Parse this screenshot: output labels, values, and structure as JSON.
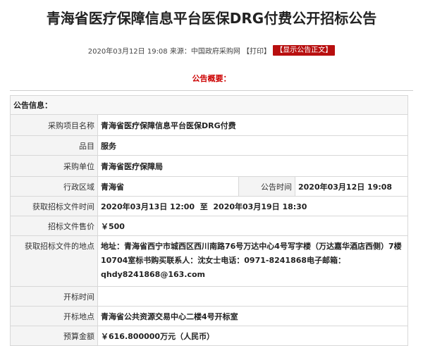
{
  "title": "青海省医疗保障信息平台医保DRG付费公开招标公告",
  "meta": {
    "datetime": "2020年03月12日 19:08",
    "source": "来源：中国政府采购网",
    "print": "【打印】",
    "show_body": "【显示公告正文】"
  },
  "overview_label": "公告概要：",
  "table": {
    "section_header": "公告信息：",
    "project_name_label": "采购项目名称",
    "project_name": "青海省医疗保障信息平台医保DRG付费",
    "category_label": "品目",
    "category": "服务",
    "purchaser_label": "采购单位",
    "purchaser": "青海省医疗保障局",
    "region_label": "行政区域",
    "region": "青海省",
    "announce_time_label": "公告时间",
    "announce_time": "2020年03月12日 19:08",
    "doc_time_label": "获取招标文件时间",
    "doc_time": "2020年03月13日 12:00  至  2020年03月19日 18:30",
    "doc_price_label": "招标文件售价",
    "doc_price": "￥500",
    "doc_place_label": "获取招标文件的地点",
    "doc_place": "地址：青海省西宁市城西区西川南路76号万达中心4号写字楼（万达嘉华酒店西侧）7楼10704室标书购买联系人：沈女士电话：0971-8241868电子邮箱：qhdy8241868@163.com",
    "bid_open_time_label": "开标时间",
    "bid_open_time": "",
    "bid_open_place_label": "开标地点",
    "bid_open_place": "青海省公共资源交易中心二楼4号开标室",
    "budget_label": "预算金额",
    "budget": "￥616.800000万元（人民币）"
  }
}
